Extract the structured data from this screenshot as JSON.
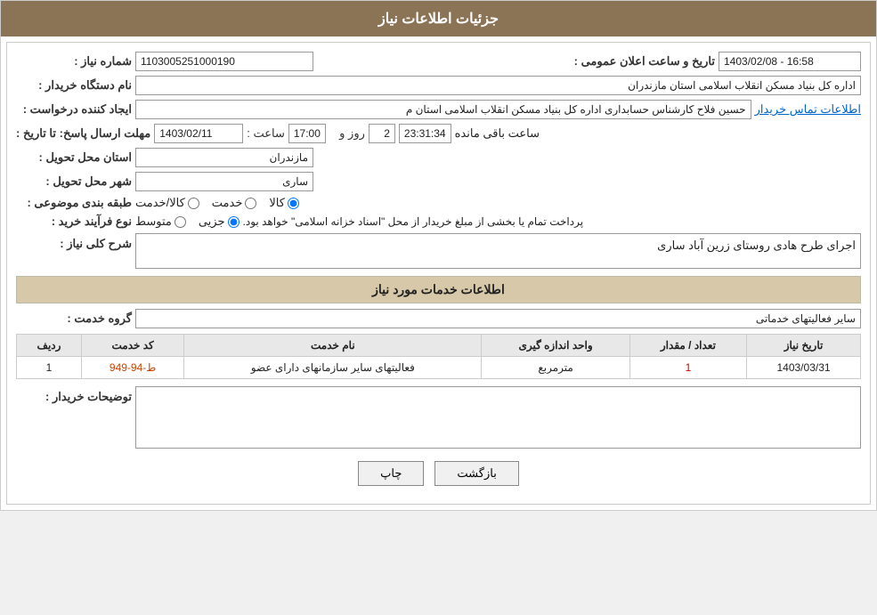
{
  "header": {
    "title": "جزئیات اطلاعات نیاز"
  },
  "fields": {
    "shomareNiaz_label": "شماره نیاز :",
    "shomareNiaz_value": "1103005251000190",
    "namDasgah_label": "نام دستگاه خریدار :",
    "namDasgah_value": "اداره کل بنیاد مسکن انقلاب اسلامی استان مازندران",
    "tarikh_label": "تاریخ و ساعت اعلان عمومی :",
    "tarikh_value": "1403/02/08 - 16:58",
    "ijadKonande_label": "ایجاد کننده درخواست :",
    "ijadKonande_value": "حسین فلاح کارشناس حسابداری اداره کل بنیاد مسکن انقلاب اسلامی استان م",
    "ijadKonande_link": "اطلاعات تماس خریدار",
    "mohlatIrsal_label": "مهلت ارسال پاسخ: تا تاریخ :",
    "tarikh2": "1403/02/11",
    "saat_label": "ساعت :",
    "saat_value": "17:00",
    "roz_label": "روز و",
    "roz_value": "2",
    "countdown": "23:31:34",
    "countdown_suffix": "ساعت باقی مانده",
    "ostan_label": "استان محل تحویل :",
    "ostan_value": "مازندران",
    "shahr_label": "شهر محل تحویل :",
    "shahr_value": "ساری",
    "tabaghe_label": "طبقه بندی موضوعی :",
    "radio_kala": "کالا",
    "radio_khedmat": "خدمت",
    "radio_kalaKhedmat": "کالا/خدمت",
    "noeFarayand_label": "نوع فرآیند خرید :",
    "radio_jozi": "جزیی",
    "radio_mottaset": "متوسط",
    "noeFarayand_note": "پرداخت تمام یا بخشی از مبلغ خریدار از محل \"اسناد خزانه اسلامی\" خواهد بود.",
    "sharhKoli_label": "شرح کلی نیاز :",
    "sharhKoli_value": "اجرای طرح هادی روستای زرین آباد ساری",
    "section_khadamat": "اطلاعات خدمات مورد نیاز",
    "groheKhadamat_label": "گروه خدمت :",
    "groheKhadamat_value": "سایر فعالیتهای خدماتی",
    "table_headers": [
      "ردیف",
      "کد خدمت",
      "نام خدمت",
      "واحد اندازه گیری",
      "تعداد / مقدار",
      "تاریخ نیاز"
    ],
    "table_rows": [
      {
        "radif": "1",
        "kodKhedmat": "ط-94-949",
        "namKhedmat": "فعالیتهای سایر سازمانهای دارای عضو",
        "vahed": "مترمربع",
        "tedad": "1",
        "tarikh": "1403/03/31"
      }
    ],
    "tosihKharidar_label": "توضیحات خریدار :",
    "btn_print": "چاپ",
    "btn_back": "بازگشت"
  }
}
